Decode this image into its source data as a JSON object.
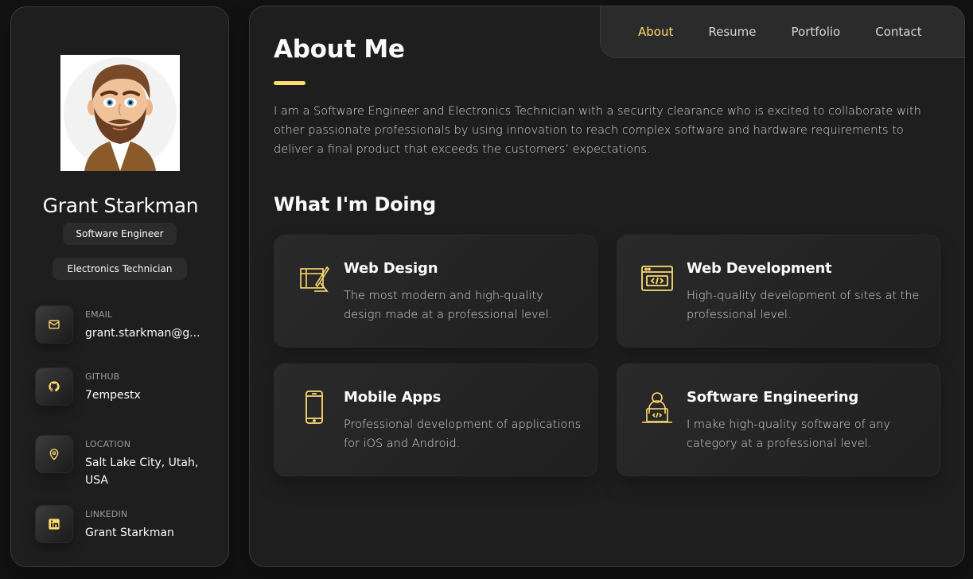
{
  "profile": {
    "name": "Grant Starkman",
    "titles": [
      "Software Engineer",
      "Electronics Technician"
    ]
  },
  "contacts": [
    {
      "label": "Email",
      "value": "grant.starkman@g...",
      "icon": "mail-icon"
    },
    {
      "label": "Github",
      "value": "7empestx",
      "icon": "github-icon"
    },
    {
      "label": "Location",
      "value": "Salt Lake City, Utah, USA",
      "icon": "location-pin-icon"
    },
    {
      "label": "LinkedIn",
      "value": "Grant Starkman",
      "icon": "linkedin-icon"
    }
  ],
  "nav": {
    "items": [
      "About",
      "Resume",
      "Portfolio",
      "Contact"
    ],
    "active": "About"
  },
  "about": {
    "title": "About Me",
    "text": "I am a Software Engineer and Electronics Technician with a security clearance who is excited to collaborate with other passionate professionals by using innovation to reach complex software and hardware requirements to deliver a final product that exceeds the customers’ expectations."
  },
  "services": {
    "title": "What I'm Doing",
    "items": [
      {
        "title": "Web Design",
        "text": "The most modern and high-quality design made at a professional level.",
        "icon": "design-icon"
      },
      {
        "title": "Web Development",
        "text": "High-quality development of sites at the professional level.",
        "icon": "code-window-icon"
      },
      {
        "title": "Mobile Apps",
        "text": "Professional development of applications for iOS and Android.",
        "icon": "smartphone-icon"
      },
      {
        "title": "Software Engineering",
        "text": "I make high-quality software of any category at a professional level.",
        "icon": "developer-icon"
      }
    ]
  },
  "colors": {
    "accent": "#ffdb70",
    "background": "#121212",
    "card": "#1e1e1f"
  }
}
